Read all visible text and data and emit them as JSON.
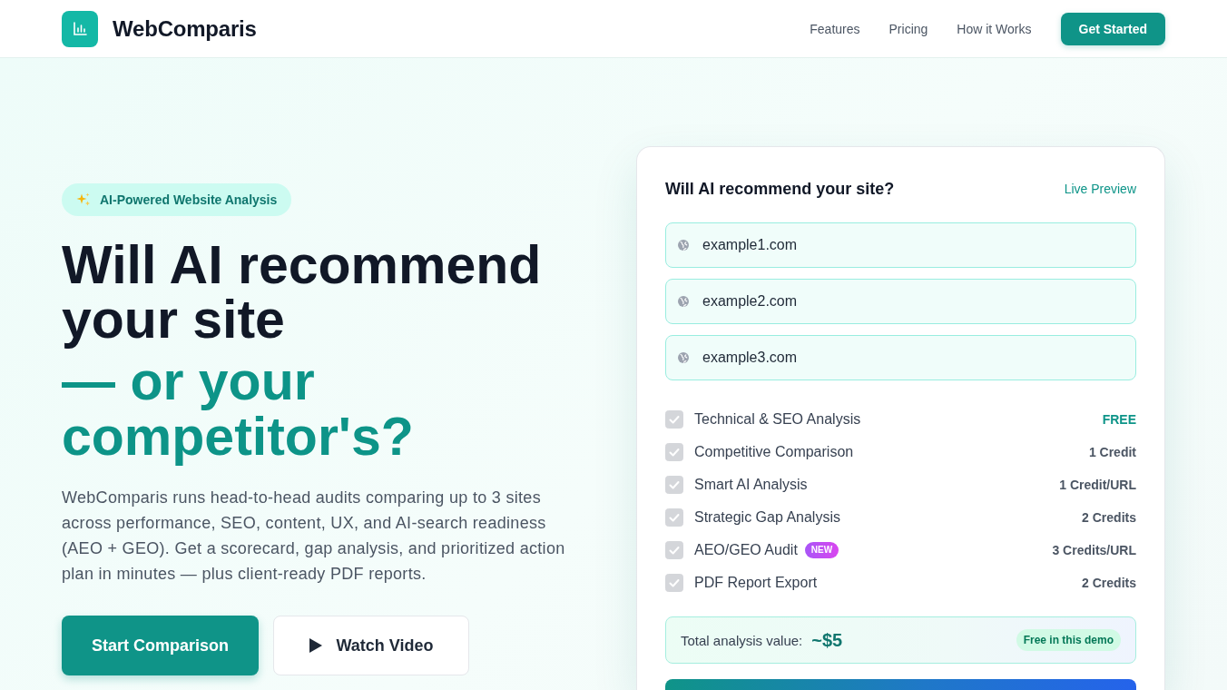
{
  "header": {
    "brand": "WebComparis",
    "nav": [
      "Features",
      "Pricing",
      "How it Works"
    ],
    "cta": "Get Started"
  },
  "hero": {
    "badge": "AI-Powered Website Analysis",
    "heading": "Will AI recommend your site",
    "heading_accent": "— or your competitor's?",
    "description": "WebComparis runs head-to-head audits comparing up to 3 sites across performance, SEO, content, UX, and AI-search readiness (AEO + GEO). Get a scorecard, gap analysis, and prioritized action plan in minutes — plus client-ready PDF reports.",
    "buttons": [
      {
        "label": "Start Comparison",
        "kind": "primary"
      },
      {
        "label": "Watch Video",
        "kind": "video"
      }
    ]
  },
  "preview": {
    "title": "Will AI recommend your site?",
    "tag": "Live Preview",
    "urls": [
      "example1.com",
      "example2.com",
      "example3.com"
    ],
    "features": [
      {
        "label": "Technical & SEO Analysis",
        "price": "FREE",
        "kind": "free",
        "checked": true,
        "disabled": true
      },
      {
        "label": "Competitive Comparison",
        "price": "1 Credit",
        "kind": "paid",
        "checked": true,
        "disabled": true
      },
      {
        "label": "Smart AI Analysis",
        "price": "1 Credit/URL",
        "kind": "paid",
        "checked": true,
        "disabled": true
      },
      {
        "label": "Strategic Gap Analysis",
        "price": "2 Credits",
        "kind": "paid",
        "checked": true,
        "disabled": true
      },
      {
        "label": "AEO/GEO Audit",
        "badge": "NEW",
        "price": "3 Credits/URL",
        "kind": "paid",
        "checked": true,
        "disabled": true
      },
      {
        "label": "PDF Report Export",
        "price": "2 Credits",
        "kind": "paid",
        "checked": true,
        "disabled": true
      }
    ],
    "total": {
      "label": "Total analysis value:",
      "value": "~$5",
      "badge": "Free in this demo"
    }
  }
}
